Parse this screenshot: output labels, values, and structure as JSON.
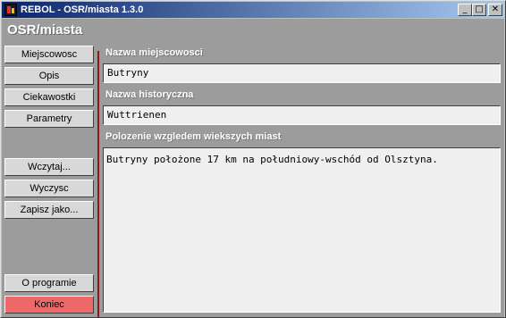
{
  "window": {
    "title": "REBOL - OSR/miasta 1.3.0",
    "controls": {
      "minimize": "_",
      "maximize": "□",
      "close": "✕"
    }
  },
  "app": {
    "title": "OSR/miasta"
  },
  "sidebar": {
    "buttons": [
      {
        "label": "Miejscowosc"
      },
      {
        "label": "Opis"
      },
      {
        "label": "Ciekawostki"
      },
      {
        "label": "Parametry"
      },
      {
        "label": "Wczytaj..."
      },
      {
        "label": "Wyczysc"
      },
      {
        "label": "Zapisz jako..."
      },
      {
        "label": "O programie"
      },
      {
        "label": "Koniec"
      }
    ]
  },
  "form": {
    "name_label": "Nazwa miejscowosci",
    "name_value": "Butryny",
    "historic_label": "Nazwa historyczna",
    "historic_value": "Wuttrienen",
    "location_label": "Polozenie wzgledem wiekszych miast",
    "location_value": "Butryny położone 17 km na południowy-wschód od Olsztyna."
  },
  "colors": {
    "quit_button": "#ee6a6a",
    "titlebar": "#0a246a",
    "accent_line": "#8b1a1a"
  }
}
